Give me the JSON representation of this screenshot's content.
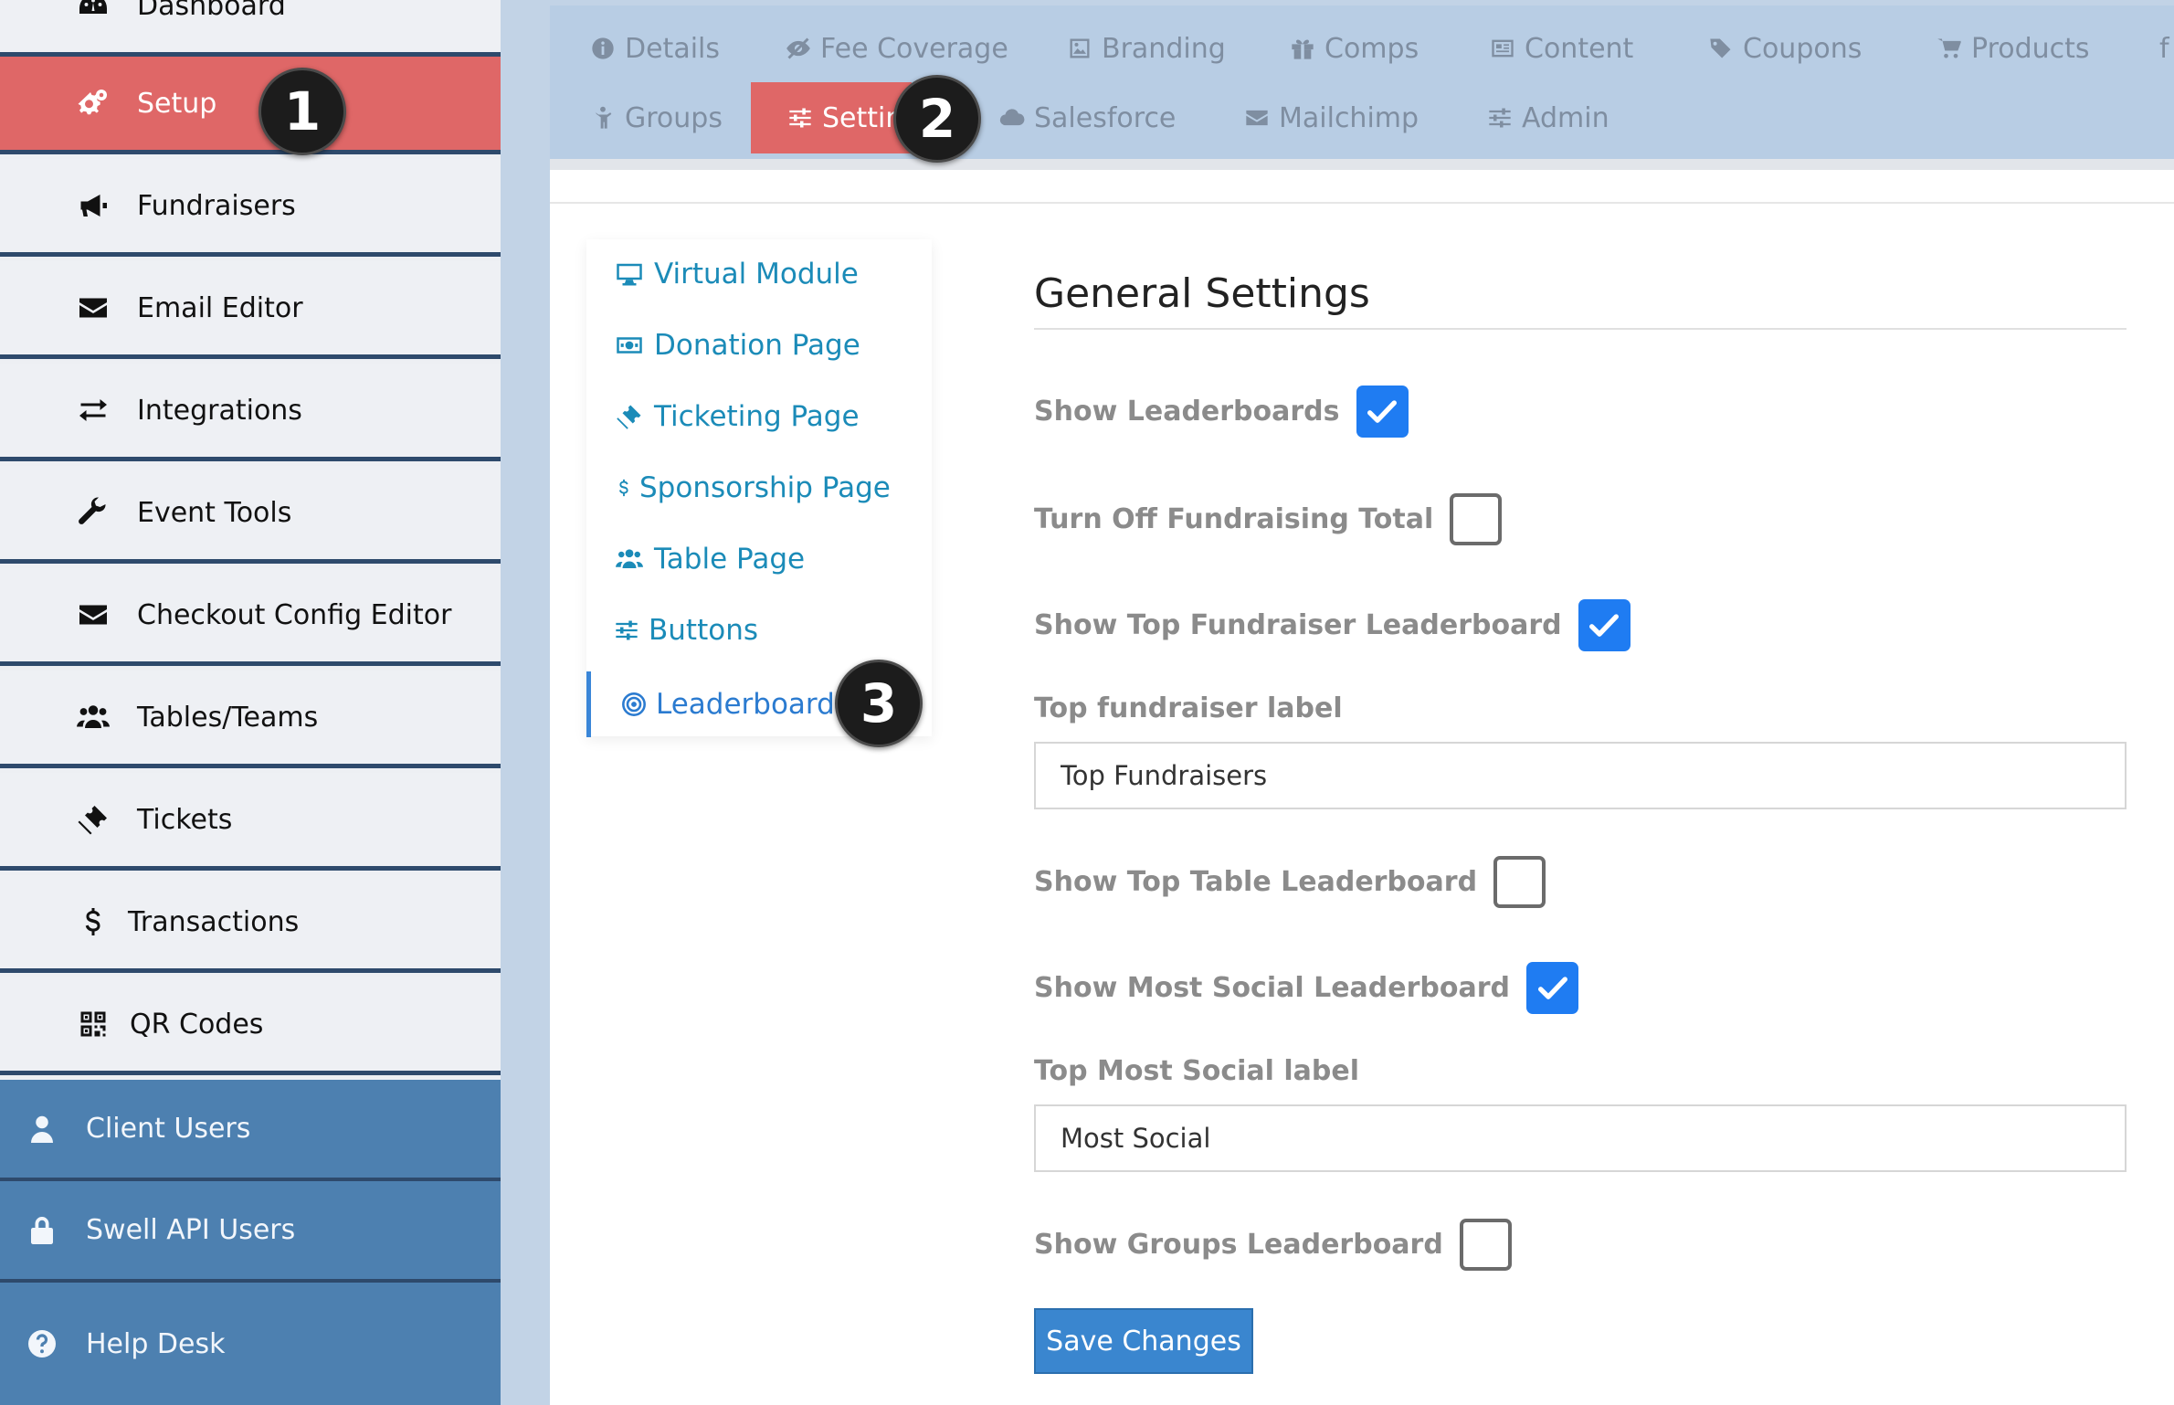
{
  "sidebar": {
    "items": [
      {
        "label": "Dashboard",
        "icon": "dashboard-icon"
      },
      {
        "label": "Setup",
        "icon": "gears-icon",
        "active": true
      },
      {
        "label": "Fundraisers",
        "icon": "bullhorn-icon"
      },
      {
        "label": "Email Editor",
        "icon": "envelope-icon"
      },
      {
        "label": "Integrations",
        "icon": "exchange-icon"
      },
      {
        "label": "Event Tools",
        "icon": "wrench-icon"
      },
      {
        "label": "Checkout Config Editor",
        "icon": "envelope-icon"
      },
      {
        "label": "Tables/Teams",
        "icon": "users-icon"
      },
      {
        "label": "Tickets",
        "icon": "ticket-icon"
      },
      {
        "label": "Transactions",
        "icon": "dollar-icon"
      },
      {
        "label": "QR Codes",
        "icon": "qrcode-icon"
      },
      {
        "label": "Client Users",
        "icon": "user-icon"
      },
      {
        "label": "Swell API Users",
        "icon": "lock-icon"
      },
      {
        "label": "Help Desk",
        "icon": "question-circle-icon"
      }
    ]
  },
  "tabs": {
    "row1": [
      {
        "label": "Details",
        "icon": "info-circle-icon"
      },
      {
        "label": "Fee Coverage",
        "icon": "eye-slash-icon"
      },
      {
        "label": "Branding",
        "icon": "image-icon"
      },
      {
        "label": "Comps",
        "icon": "gift-icon"
      },
      {
        "label": "Content",
        "icon": "newspaper-icon"
      },
      {
        "label": "Coupons",
        "icon": "tags-icon"
      },
      {
        "label": "Products",
        "icon": "cart-icon"
      }
    ],
    "row2": [
      {
        "label": "Groups",
        "icon": "child-icon"
      },
      {
        "label": "Settings",
        "icon": "sliders-icon",
        "active": true
      },
      {
        "label": "Salesforce",
        "icon": "cloud-icon"
      },
      {
        "label": "Mailchimp",
        "icon": "envelope-icon"
      },
      {
        "label": "Admin",
        "icon": "sliders-icon"
      }
    ]
  },
  "subnav": {
    "items": [
      {
        "label": "Virtual Module",
        "icon": "desktop-icon"
      },
      {
        "label": "Donation Page",
        "icon": "money-icon"
      },
      {
        "label": "Ticketing Page",
        "icon": "ticket-icon"
      },
      {
        "label": "Sponsorship Page",
        "icon": "dollar-icon"
      },
      {
        "label": "Table Page",
        "icon": "users-icon"
      },
      {
        "label": "Buttons",
        "icon": "sliders-icon"
      },
      {
        "label": "Leaderboards",
        "icon": "bullseye-icon",
        "active": true
      }
    ]
  },
  "settings": {
    "title": "General Settings",
    "show_leaderboards": {
      "label": "Show Leaderboards",
      "checked": true
    },
    "turn_off_total": {
      "label": "Turn Off Fundraising Total",
      "checked": false
    },
    "show_top_fundraiser": {
      "label": "Show Top Fundraiser Leaderboard",
      "checked": true
    },
    "top_fundraiser_label": {
      "label": "Top fundraiser label",
      "value": "Top Fundraisers"
    },
    "show_top_table": {
      "label": "Show Top Table Leaderboard",
      "checked": false
    },
    "show_most_social": {
      "label": "Show Most Social Leaderboard",
      "checked": true
    },
    "top_most_social_label": {
      "label": "Top Most Social label",
      "value": "Most Social"
    },
    "show_groups": {
      "label": "Show Groups Leaderboard",
      "checked": false
    },
    "save_label": "Save Changes"
  },
  "markers": [
    "1",
    "2",
    "3"
  ],
  "colors": {
    "accent_red": "#df6767",
    "sidebar_blue": "#4d80b0",
    "checkbox_blue": "#1f7cf2",
    "link_teal": "#1b8bb8"
  }
}
